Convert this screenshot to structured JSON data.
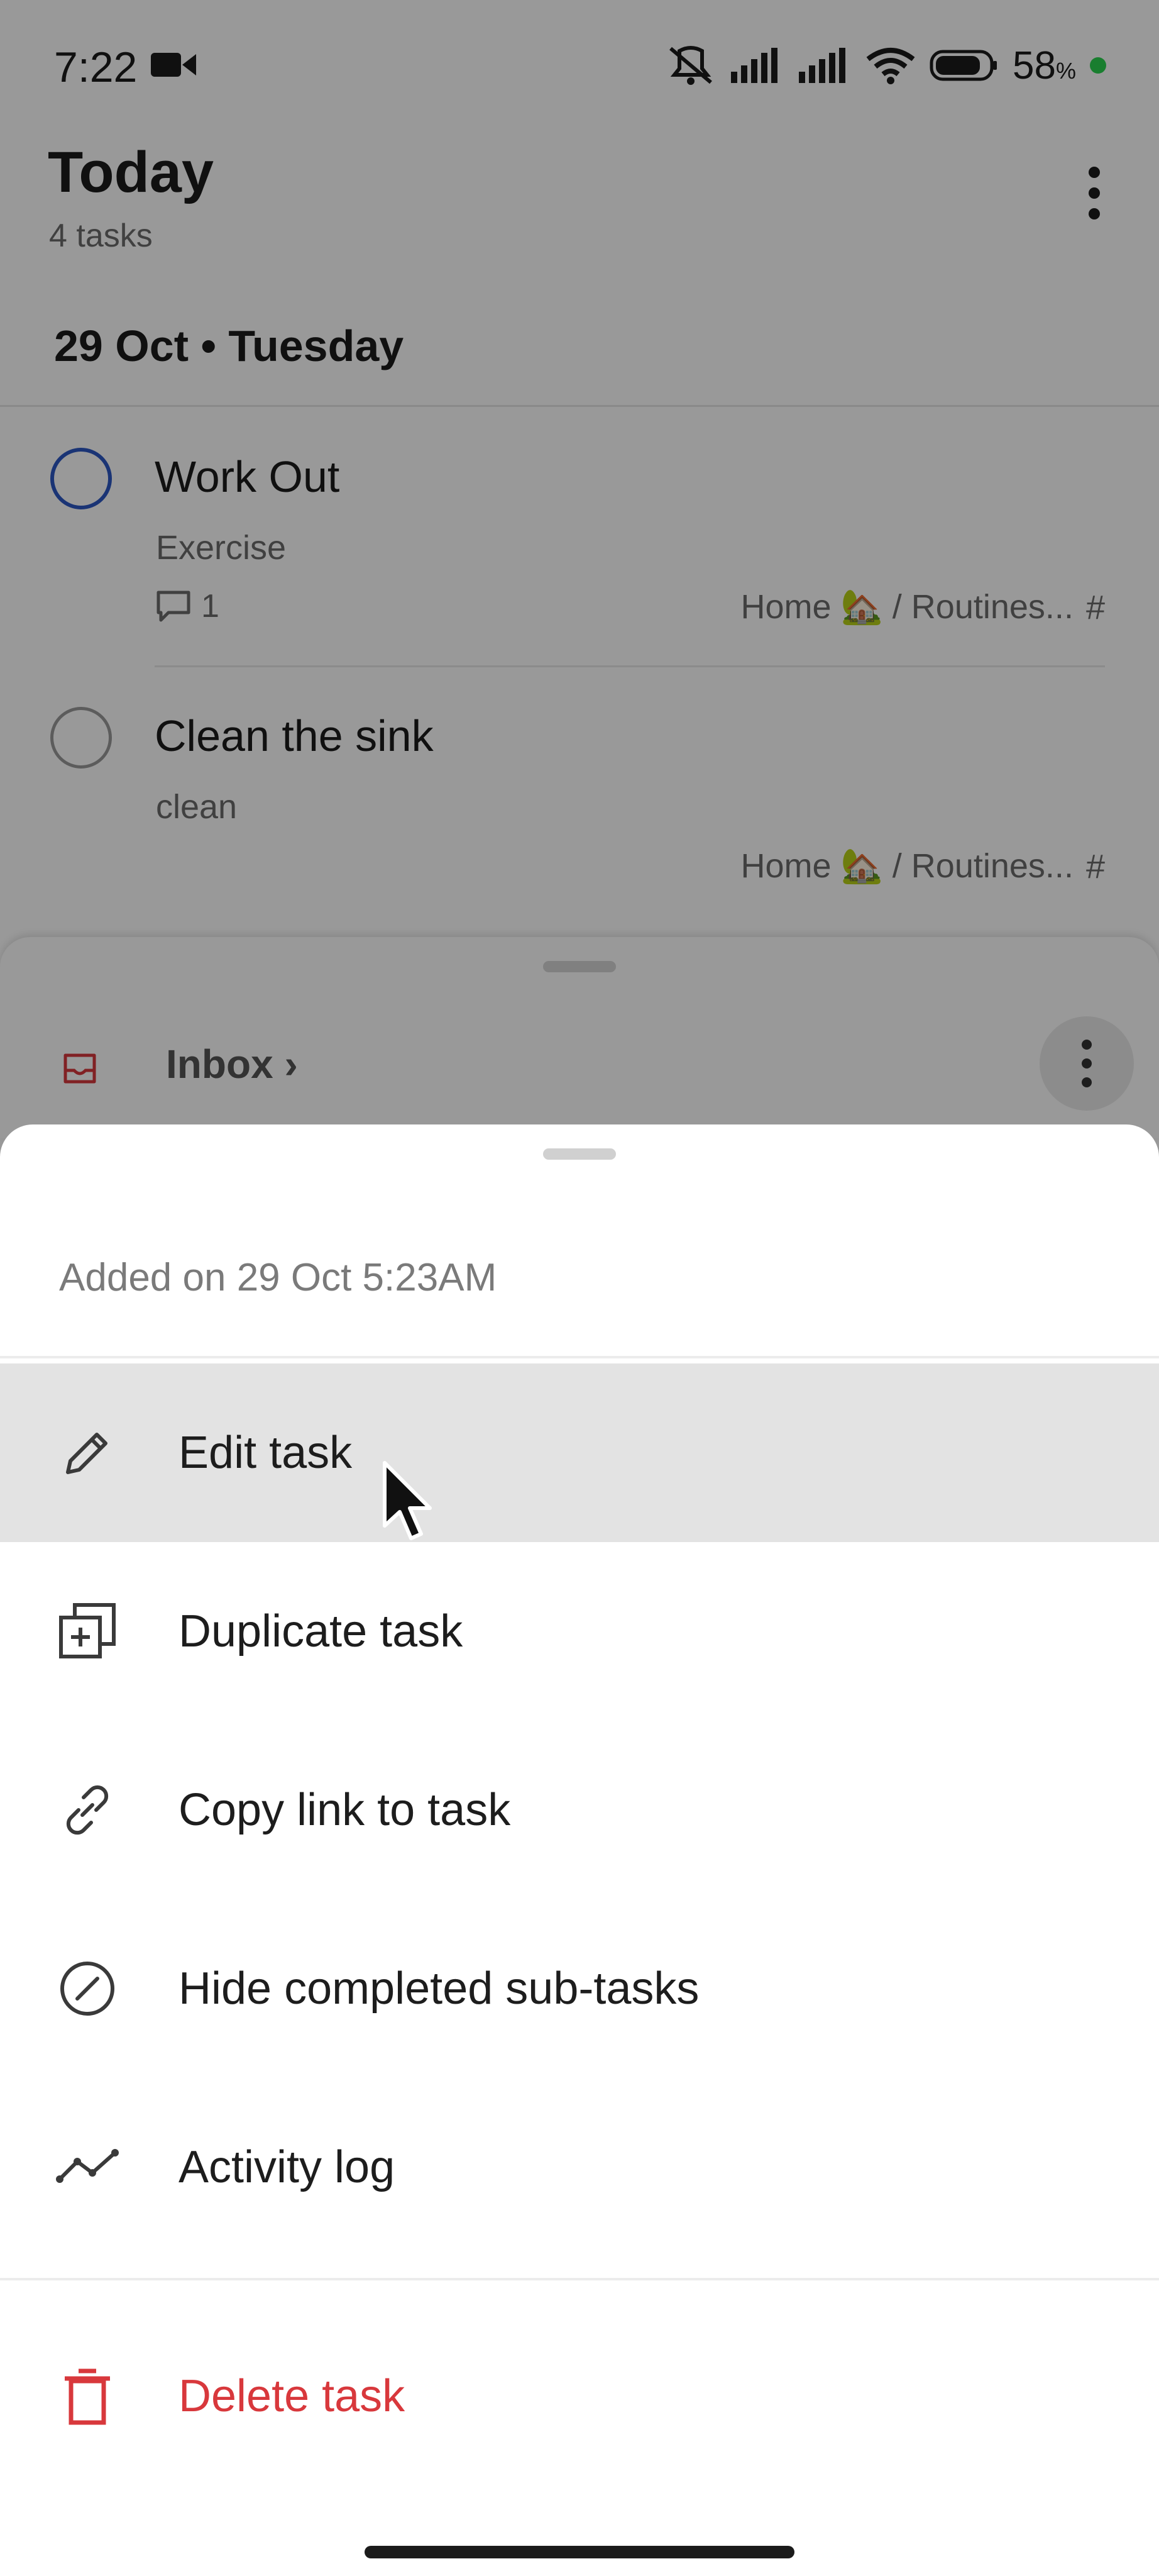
{
  "status_bar": {
    "time": "7:22",
    "battery_percent": "58",
    "battery_unit": "%"
  },
  "header": {
    "title": "Today",
    "subtitle": "4 tasks"
  },
  "section": {
    "date": "29 Oct • Tuesday"
  },
  "tasks": [
    {
      "title": "Work Out",
      "description": "Exercise",
      "comment_count": "1",
      "project": "Home 🏡 / Routines...",
      "checkbox_color": "#2c57c4"
    },
    {
      "title": "Clean the sink",
      "description": "clean",
      "project": "Home 🏡 / Routines...",
      "checkbox_color": "#9a9a9a"
    }
  ],
  "bottom_bar": {
    "label": "Inbox"
  },
  "sheet": {
    "added": "Added on 29 Oct 5:23AM",
    "items": [
      {
        "label": "Edit task",
        "icon": "pencil-icon"
      },
      {
        "label": "Duplicate task",
        "icon": "duplicate-icon"
      },
      {
        "label": "Copy link to task",
        "icon": "link-icon"
      },
      {
        "label": "Hide completed sub-tasks",
        "icon": "hide-completed-icon"
      },
      {
        "label": "Activity log",
        "icon": "activity-icon"
      }
    ],
    "delete_label": "Delete task",
    "delete_color": "#d8383c"
  }
}
